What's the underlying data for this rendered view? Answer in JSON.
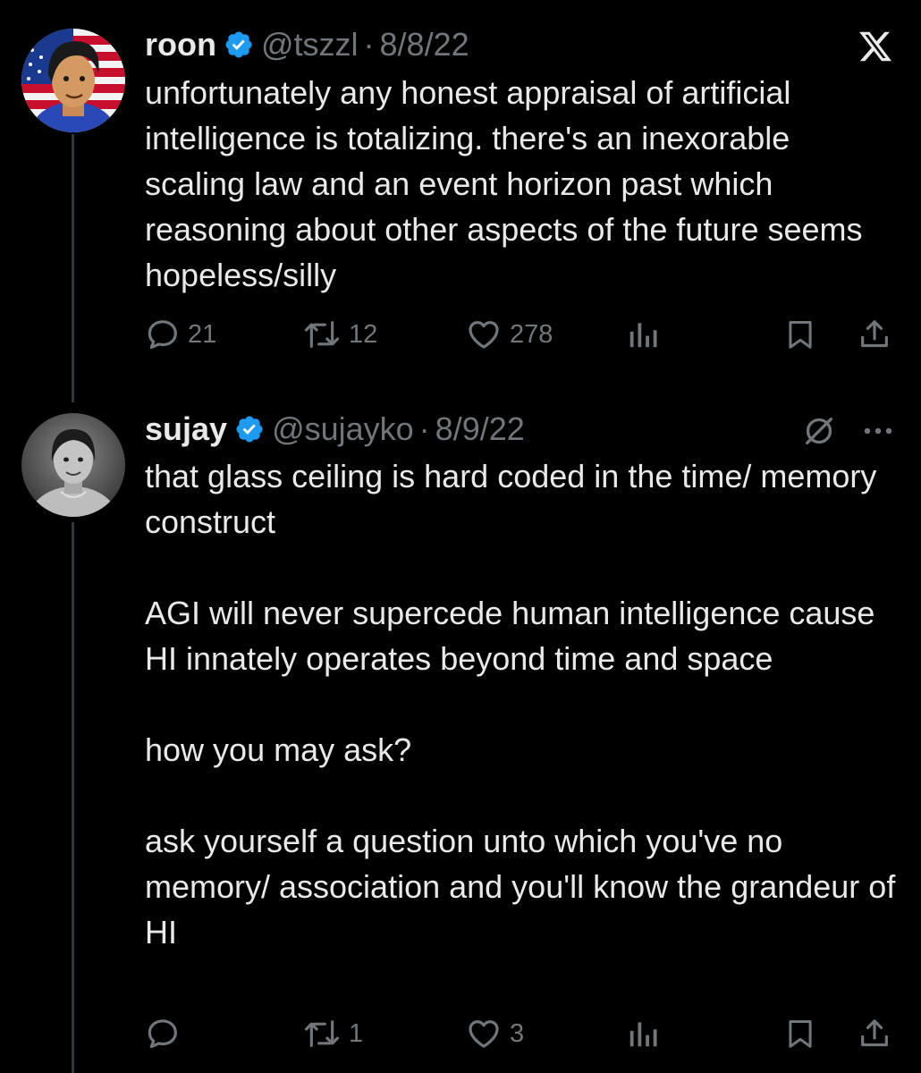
{
  "tweets": [
    {
      "display_name": "roon",
      "handle": "@tszzl",
      "separator": "·",
      "date": "8/8/22",
      "body": [
        "unfortunately any honest appraisal of artificial intelligence is totalizing. there's an inexorable scaling law and an event horizon past which reasoning about other aspects of the future seems hopeless/silly"
      ],
      "replies": "21",
      "retweets": "12",
      "likes": "278",
      "top_right_icon": "x-logo-icon"
    },
    {
      "display_name": "sujay",
      "handle": "@sujayko",
      "separator": "·",
      "date": "8/9/22",
      "body": [
        "that glass ceiling is hard coded in the time/ memory construct",
        "AGI will never supercede human intelligence cause HI innately operates beyond time and space",
        "how you may ask?",
        "ask yourself a question unto which you've no memory/ association and you'll know the grandeur of HI"
      ],
      "replies": "",
      "retweets": "1",
      "likes": "3",
      "top_right_icons": [
        "grok-icon",
        "more-icon"
      ]
    }
  ],
  "colors": {
    "background": "#000000",
    "text": "#e7e9ea",
    "muted": "#71767b",
    "verified": "#1d9bf0",
    "thread_line": "#333639"
  }
}
